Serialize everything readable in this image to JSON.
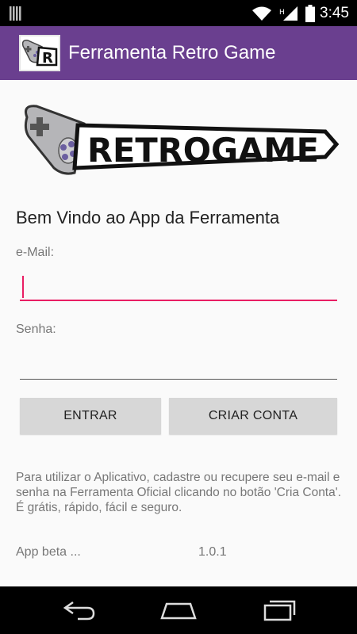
{
  "status_bar": {
    "time": "3:45",
    "icons": [
      "notification-bars-icon",
      "wifi-icon",
      "signal-icon",
      "battery-icon"
    ]
  },
  "app_bar": {
    "title": "Ferramenta Retro Game",
    "background": "#6a3f8f"
  },
  "logo": {
    "text": "RETROGAME"
  },
  "main": {
    "welcome": "Bem Vindo ao App da Ferramenta",
    "email_label": "e-Mail:",
    "email_value": "",
    "password_label": "Senha:",
    "password_value": "",
    "accent": "#e91e63",
    "enter_button": "ENTRAR",
    "create_button": "CRIAR CONTA",
    "info_text": "Para utilizar o Aplicativo, cadastre ou recupere seu e-mail e senha na Ferramenta Oficial clicando no botão 'Cria Conta'. É grátis, rápido, fácil e seguro.",
    "beta_label": "App beta ...",
    "version": "1.0.1"
  },
  "nav_bar": {
    "icons": [
      "back-icon",
      "home-icon",
      "recents-icon"
    ]
  }
}
